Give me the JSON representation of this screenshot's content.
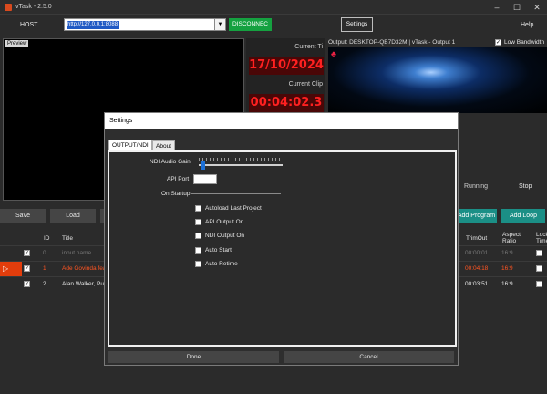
{
  "window": {
    "title": "vTask - 2.5.0",
    "minimize": "–",
    "maximize": "☐",
    "close": "✕"
  },
  "header": {
    "host_label": "HOST",
    "url": "http://127.0.0.1:8088",
    "disconnect_label": "DISCONNEC",
    "settings_label": "Settings",
    "help_label": "Help"
  },
  "preview": {
    "label": "Preview"
  },
  "clock": {
    "current_time_label": "Current Ti",
    "current_date": "17/10/2024",
    "current_clip_label": "Current Clip",
    "current_clip_time": "00:04:02.3"
  },
  "output": {
    "title": "Output: DESKTOP-QB7D32M | vTask - Output 1",
    "low_bandwidth_label": "Low Bandwidth",
    "low_bandwidth_checked": "✓",
    "running_label": "Running",
    "stop_label": "Stop"
  },
  "toolbar": {
    "save_label": "Save",
    "load_label": "Load",
    "add_program_label": "Add Program",
    "add_loop_label": "Add Loop"
  },
  "table": {
    "headers": {
      "id": "ID",
      "title": "Title",
      "trim_out": "TrimOut",
      "aspect_ratio": "Aspect Ratio",
      "lock": "Lock Time"
    },
    "rows": [
      {
        "check": "✓",
        "id": "0",
        "title": "input name",
        "trim_out": "00:00:01",
        "aspect": "16:9"
      },
      {
        "marker": "▷",
        "check": "✓",
        "id": "1",
        "title": "Ade Govinda feat",
        "trim_out": "00:04:18",
        "aspect": "16:9"
      },
      {
        "check": "✓",
        "id": "2",
        "title": "Alan Walker, Put",
        "trim_out": "00:03:51",
        "aspect": "16:9"
      }
    ]
  },
  "dialog": {
    "title": "Settings",
    "tabs": {
      "output_ndi": "OUTPUT/NDI",
      "about": "About"
    },
    "ndi_audio_gain_label": "NDI Audio Gain",
    "ndi_audio_gain": 0.02,
    "api_port_label": "API Port",
    "api_port_value": "",
    "on_startup_label": "On Startup",
    "options": {
      "autoload": "Autoload Last Project",
      "api_output": "API Output On",
      "ndi_output": "NDI Output On",
      "auto_start": "Auto Start",
      "auto_retime": "Auto Retime"
    },
    "done_label": "Done",
    "cancel_label": "Cancel"
  },
  "colors": {
    "accent": "#1b8f86",
    "connected": "#15a140",
    "clock_red": "#ff2020",
    "playing_row": "#e23d0c"
  }
}
